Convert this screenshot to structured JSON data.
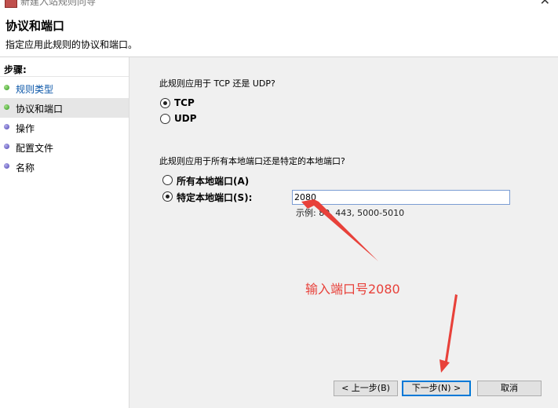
{
  "window": {
    "title": "新建入站规则向导",
    "close_glyph": "✕"
  },
  "header": {
    "title": "协议和端口",
    "subtitle": "指定应用此规则的协议和端口。"
  },
  "sidebar": {
    "title": "步骤:",
    "items": [
      {
        "label": "规则类型",
        "state": "done"
      },
      {
        "label": "协议和端口",
        "state": "current"
      },
      {
        "label": "操作",
        "state": "pending"
      },
      {
        "label": "配置文件",
        "state": "pending"
      },
      {
        "label": "名称",
        "state": "pending"
      }
    ]
  },
  "protocol": {
    "question": "此规则应用于 TCP 还是 UDP?",
    "options": [
      {
        "label": "TCP",
        "checked": true
      },
      {
        "label": "UDP",
        "checked": false
      }
    ]
  },
  "ports": {
    "question": "此规则应用于所有本地端口还是特定的本地端口?",
    "options": [
      {
        "label": "所有本地端口(A)",
        "checked": false
      },
      {
        "label": "特定本地端口(S):",
        "checked": true
      }
    ],
    "value": "2080",
    "example": "示例: 80, 443, 5000-5010"
  },
  "buttons": {
    "back": "< 上一步(B)",
    "next": "下一步(N) >",
    "cancel": "取消"
  },
  "annotation": {
    "text": "输入端口号2080",
    "color": "#e8413a"
  },
  "colors": {
    "accent": "#0078d7",
    "step_done": "#2f9a1e",
    "step_pending": "#4d44b5",
    "link": "#0a56a8"
  }
}
